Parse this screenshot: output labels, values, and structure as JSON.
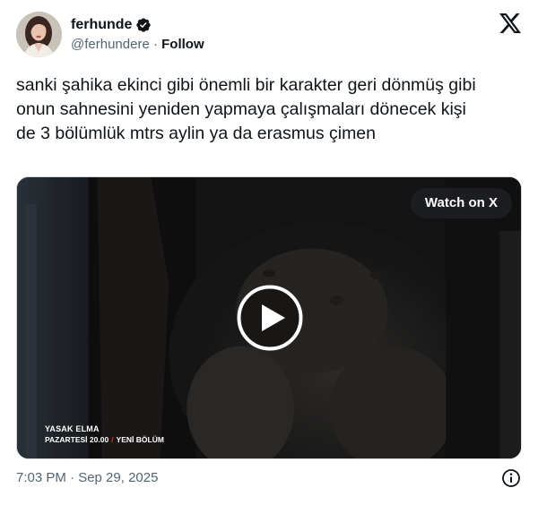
{
  "author": {
    "display_name": "ferhunde",
    "handle": "@ferhundere",
    "separator": "·",
    "follow_label": "Follow",
    "verified_icon": "verified-badge-icon",
    "avatar_icon": "profile-avatar"
  },
  "platform_icon": "x-logo-icon",
  "tweet": {
    "text": "sanki şahika ekinci gibi önemli bir karakter geri dönmüş gibi\nonun sahnesini yeniden yapmaya çalışmaları dönecek kişi\nde 3 bölümlük mtrs aylin ya da erasmus çimen"
  },
  "media": {
    "watch_label": "Watch on X",
    "play_icon": "play-icon",
    "overlay_title": "YASAK ELMA",
    "overlay_day_time": "PAZARTESİ 20.00",
    "overlay_slash": "/",
    "overlay_episode": "YENİ BÖLÜM"
  },
  "footer": {
    "timestamp": "7:03 PM · Sep 29, 2025",
    "info_icon": "info-icon"
  },
  "colors": {
    "text_primary": "#0f1419",
    "text_secondary": "#536471",
    "verified": "#0f1419",
    "overlay_accent": "#e0342c"
  }
}
